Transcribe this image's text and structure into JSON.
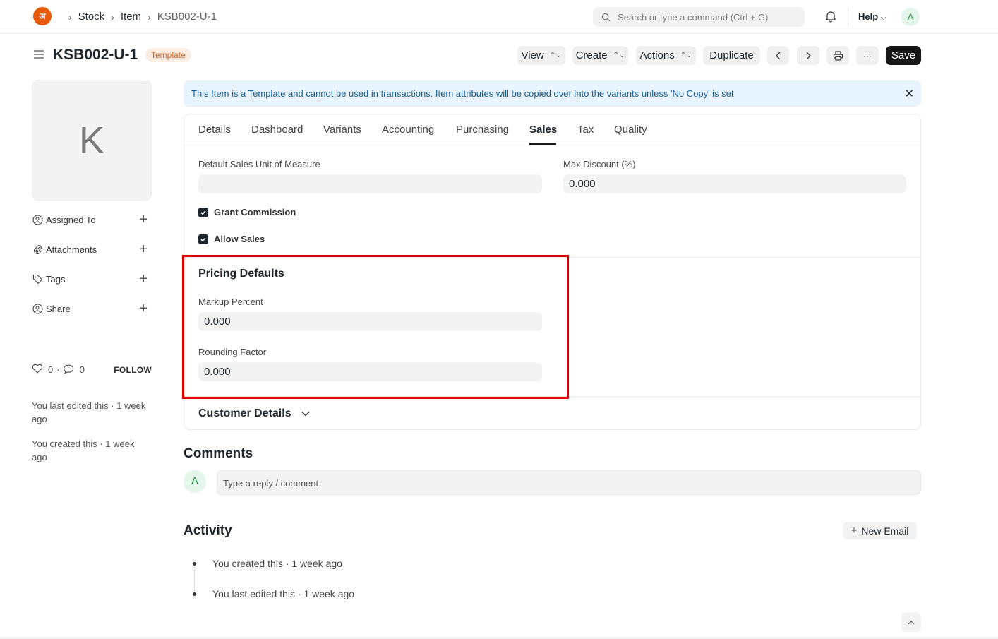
{
  "topbar": {
    "breadcrumbs": [
      "Stock",
      "Item",
      "KSB002-U-1"
    ],
    "search_placeholder": "Search or type a command (Ctrl + G)",
    "help_label": "Help",
    "avatar_letter": "A",
    "logo_text": "अ"
  },
  "titlebar": {
    "title": "KSB002-U-1",
    "badge": "Template",
    "buttons": {
      "view": "View",
      "create": "Create",
      "actions": "Actions",
      "duplicate": "Duplicate",
      "more": "···",
      "save": "Save"
    }
  },
  "sidebar": {
    "image_letter": "K",
    "items": [
      {
        "label": "Assigned To",
        "icon": "assign-icon"
      },
      {
        "label": "Attachments",
        "icon": "paperclip-icon"
      },
      {
        "label": "Tags",
        "icon": "tag-icon"
      },
      {
        "label": "Share",
        "icon": "share-icon"
      }
    ],
    "likes_count": "0",
    "comments_count": "0",
    "follow_label": "FOLLOW",
    "last_edited": "You last edited this · 1 week ago",
    "created": "You created this · 1 week ago"
  },
  "alert": {
    "text": "This Item is a Template and cannot be used in transactions. Item attributes will be copied over into the variants unless 'No Copy' is set",
    "close": "✕"
  },
  "tabs": [
    "Details",
    "Dashboard",
    "Variants",
    "Accounting",
    "Purchasing",
    "Sales",
    "Tax",
    "Quality"
  ],
  "active_tab": "Sales",
  "form": {
    "default_sales_uom_label": "Default Sales Unit of Measure",
    "default_sales_uom_value": "",
    "max_discount_label": "Max Discount (%)",
    "max_discount_value": "0.000",
    "grant_commission_label": "Grant Commission",
    "grant_commission_checked": true,
    "allow_sales_label": "Allow Sales",
    "allow_sales_checked": true,
    "pricing_defaults_title": "Pricing Defaults",
    "markup_percent_label": "Markup Percent",
    "markup_percent_value": "0.000",
    "rounding_factor_label": "Rounding Factor",
    "rounding_factor_value": "0.000",
    "customer_details_title": "Customer Details"
  },
  "comments": {
    "title": "Comments",
    "avatar_letter": "A",
    "placeholder": "Type a reply / comment"
  },
  "activity": {
    "title": "Activity",
    "new_email_label": "New Email",
    "items": [
      "You created this · 1 week ago",
      "You last edited this · 1 week ago"
    ]
  },
  "colors": {
    "accent_dark": "#171717",
    "badge_bg": "#fdeee4",
    "badge_text": "#e2580d",
    "alert_bg": "#e8f4fd",
    "highlight": "#e00000"
  }
}
